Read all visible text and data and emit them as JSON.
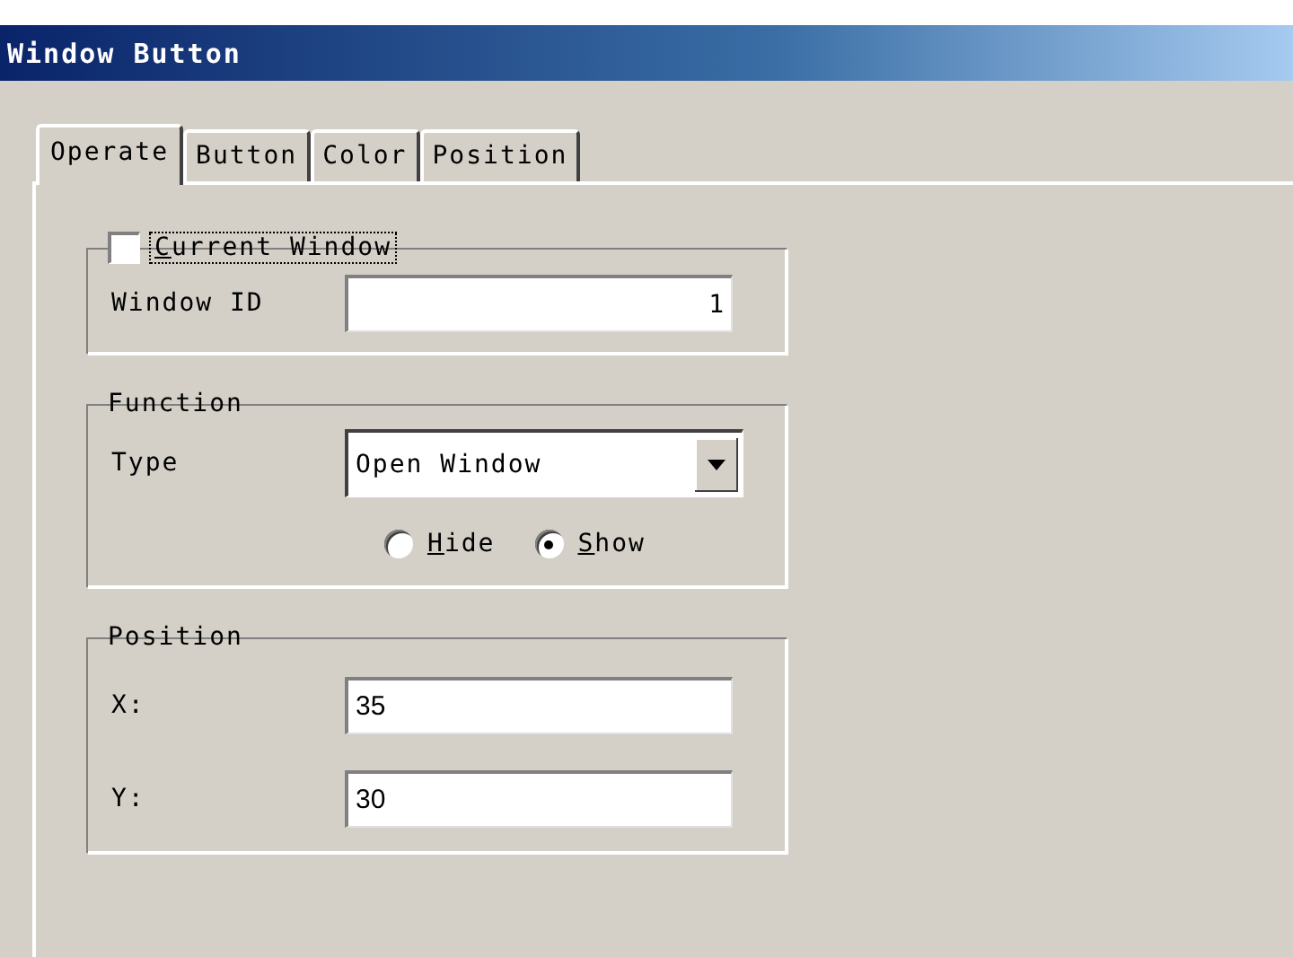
{
  "window": {
    "title": "Window Button"
  },
  "tabs": [
    {
      "label": "Operate",
      "selected": true
    },
    {
      "label": "Button",
      "selected": false
    },
    {
      "label": "Color",
      "selected": false
    },
    {
      "label": "Position",
      "selected": false
    }
  ],
  "current_window": {
    "label": "Current Window",
    "checked": false,
    "window_id_label": "Window ID",
    "window_id": "1"
  },
  "function": {
    "title": "Function",
    "type_label": "Type",
    "type_value": "Open Window",
    "options": [
      {
        "label": "Hide",
        "selected": false
      },
      {
        "label": "Show",
        "selected": true
      }
    ]
  },
  "position": {
    "title": "Position",
    "fields": [
      {
        "label": "X:",
        "value": "35"
      },
      {
        "label": "Y:",
        "value": "30"
      }
    ]
  }
}
